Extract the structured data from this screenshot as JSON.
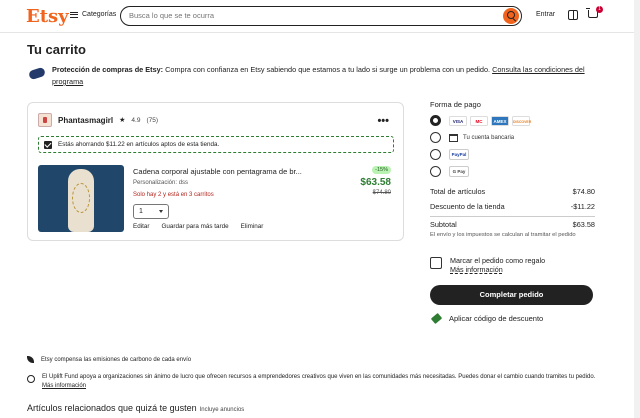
{
  "header": {
    "logo": "Etsy",
    "categories_label": "Categorías",
    "search_placeholder": "Busca lo que se te ocurra",
    "signin_label": "Entrar",
    "cart_count": "1"
  },
  "page_title": "Tu carrito",
  "protection": {
    "bold": "Protección de compras de Etsy:",
    "text": " Compra con confianza en Etsy sabiendo que estamos a tu lado si surge un problema con un pedido. ",
    "link": "Consulta las condiciones del programa"
  },
  "shop": {
    "name": "Phantasmagirl",
    "rating": "4.9",
    "reviews": "(75)",
    "more_label": "•••",
    "saving_text": "Estás ahorrando $11.22 en artículos aptos de esta tienda.",
    "item": {
      "title": "Cadena corporal ajustable con pentagrama de br...",
      "personalization": "Personalización: dss",
      "stock": "Solo hay 2 y está en 3 carritos",
      "quantity": "1",
      "discount_badge": "-15%",
      "price": "$63.58",
      "old_price": "$74.80",
      "actions": [
        "Editar",
        "Guardar para más tarde",
        "Eliminar"
      ]
    }
  },
  "payment": {
    "title": "Forma de pago",
    "card_logos": [
      "VISA",
      "MC",
      "AMEX",
      "DISCOVER"
    ],
    "bank_label": "Tu cuenta bancaria",
    "paypal_label": "PayPal",
    "gpay_label": "G Pay"
  },
  "totals": {
    "items_label": "Total de artículos",
    "items_value": "$74.80",
    "discount_label": "Descuento de la tienda",
    "discount_value": "-$11.22",
    "subtotal_label": "Subtotal",
    "subtotal_value": "$63.58",
    "tax_note": "El envío y los impuestos se calculan al tramitar el pedido"
  },
  "gift": {
    "label": "Marcar el pedido como regalo",
    "more_info": "Más información"
  },
  "checkout_label": "Completar pedido",
  "coupon_label": "Aplicar código de descuento",
  "footer": {
    "carbon": "Etsy compensa las emisiones de carbono de cada envío",
    "uplift": "El Uplift Fund apoya a organizaciones sin ánimo de lucro que ofrecen recursos a emprendedores creativos que viven en las comunidades más necesitadas. Puedes donar el cambio cuando tramites tu pedido. ",
    "uplift_link": "Más información",
    "related": "Artículos relacionados que quizá te gusten",
    "related_note": "Incluye anuncios"
  },
  "colors": {
    "brand": "#f1641e",
    "price_green": "#2e7d32",
    "stock_red": "#b3261e"
  }
}
